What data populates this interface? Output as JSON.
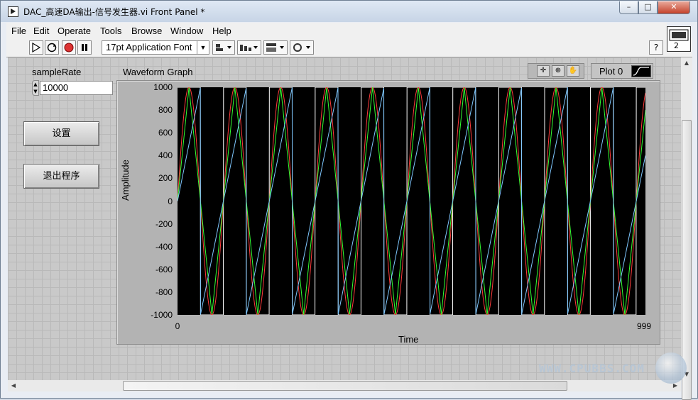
{
  "window": {
    "title": "DAC_高速DA输出-信号发生器.vi Front Panel *",
    "min_glyph": "–",
    "max_glyph": "□",
    "close_glyph": "✕"
  },
  "menu": [
    "File",
    "Edit",
    "Operate",
    "Tools",
    "Browse",
    "Window",
    "Help"
  ],
  "toolbar": {
    "font": "17pt Application Font",
    "help_glyph": "?",
    "connector_number": "2"
  },
  "controls": {
    "sample_rate_label": "sampleRate",
    "sample_rate_value": "10000",
    "set_button": "设置",
    "exit_button": "退出程序"
  },
  "graph": {
    "label": "Waveform Graph",
    "legend_plot": "Plot 0",
    "xlabel": "Time",
    "ylabel": "Amplitude"
  },
  "chart_data": {
    "type": "line",
    "title": "Waveform Graph",
    "xlabel": "Time",
    "ylabel": "Amplitude",
    "xlim": [
      0,
      999
    ],
    "ylim": [
      -1000,
      1000
    ],
    "x_ticks": [
      "0",
      "999"
    ],
    "y_ticks": [
      "1000",
      "800",
      "600",
      "400",
      "200",
      "0",
      "-200",
      "-400",
      "-600",
      "-800",
      "-1000"
    ],
    "background": "#000000",
    "cycles": 10.2,
    "series": [
      {
        "shape": "square",
        "amplitude": 1000,
        "color": "#ffffff"
      },
      {
        "shape": "sine",
        "amplitude": 1000,
        "color": "#ff3b3b"
      },
      {
        "shape": "triangle",
        "amplitude": 1000,
        "color": "#33ff33"
      },
      {
        "shape": "sawtooth",
        "amplitude": 1000,
        "color": "#7fc8ff"
      }
    ]
  },
  "watermark": "WWW.CPUBBS.COM"
}
